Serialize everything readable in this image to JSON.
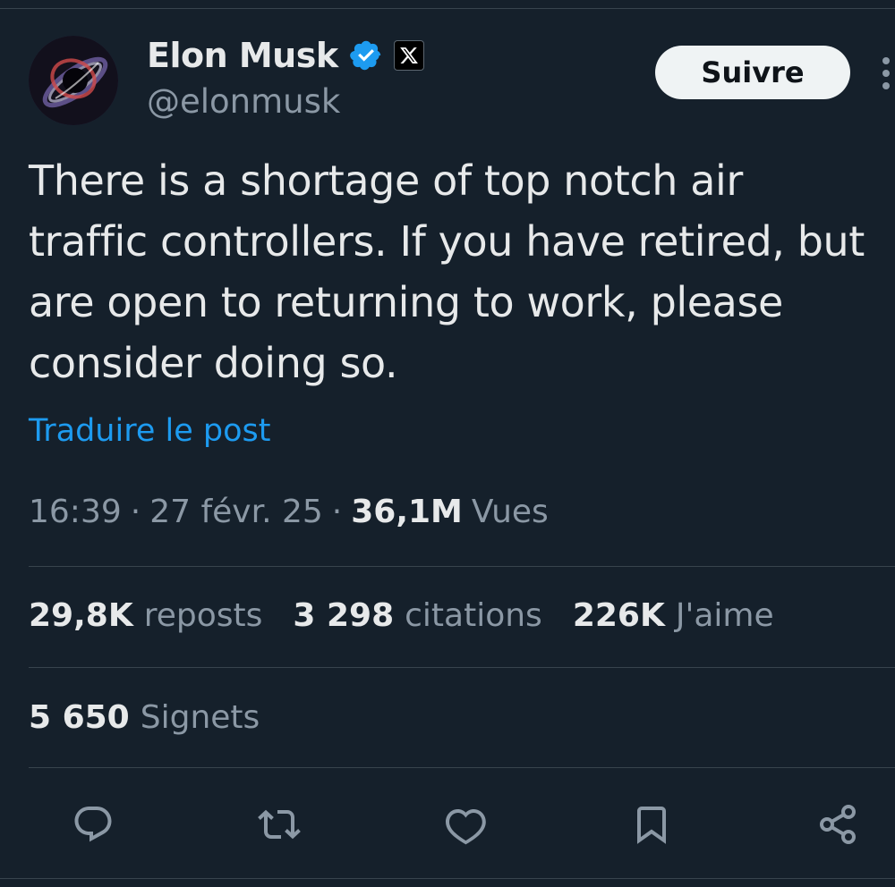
{
  "author": {
    "display_name": "Elon Musk",
    "handle": "@elonmusk",
    "verified_icon": "verified-badge-icon",
    "affiliate_icon": "x-logo-icon"
  },
  "follow_button": {
    "label": "Suivre"
  },
  "more_icon": "more-vertical-icon",
  "tweet": {
    "text": "There is a shortage of top notch air traffic controllers. If you have retired, but are open to returning to work, please consider doing so.",
    "translate_label": "Traduire le post"
  },
  "meta": {
    "time": "16:39",
    "separator": "·",
    "date": "27 févr. 25",
    "views_count": "36,1M",
    "views_label": "Vues"
  },
  "stats": {
    "reposts_count": "29,8K",
    "reposts_label": "reposts",
    "quotes_count": "3 298",
    "quotes_label": "citations",
    "likes_count": "226K",
    "likes_label": "J'aime",
    "bookmarks_count": "5 650",
    "bookmarks_label": "Signets"
  },
  "actions": [
    "reply-icon",
    "repost-icon",
    "like-icon",
    "bookmark-icon",
    "share-icon"
  ],
  "colors": {
    "background": "#15202b",
    "text": "#e7e9ea",
    "muted": "#8b98a5",
    "accent": "#1d9bf0",
    "divider": "#38444d"
  }
}
